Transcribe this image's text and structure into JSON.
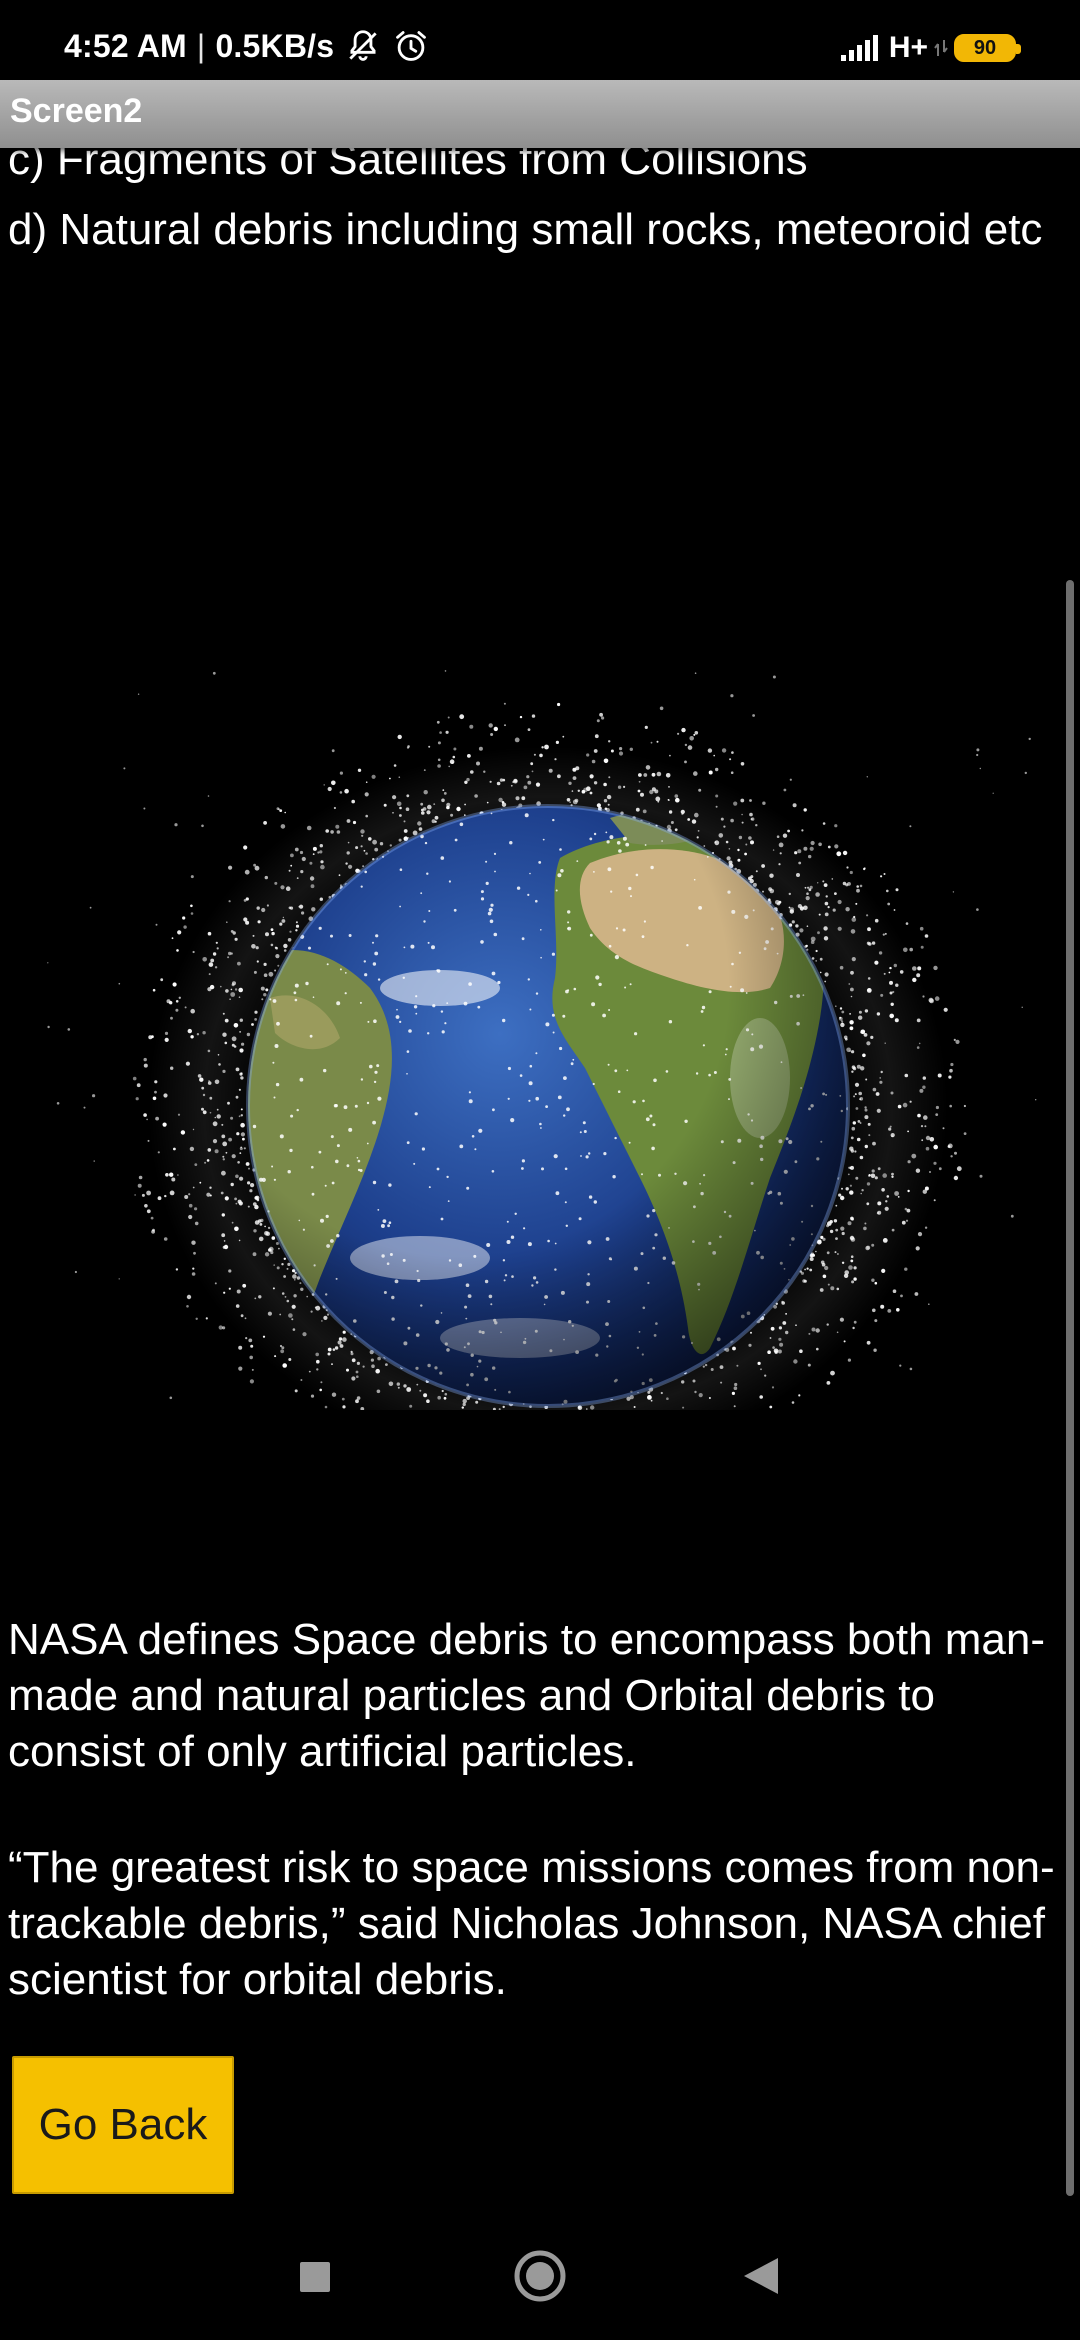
{
  "status_bar": {
    "time": "4:52 AM",
    "separator": "|",
    "net_speed": "0.5KB/s",
    "network_type": "H+",
    "battery_level": "90",
    "icons": [
      "notifications-off-icon",
      "alarm-icon",
      "signal-icon",
      "battery-icon"
    ]
  },
  "app_bar": {
    "title": "Screen2"
  },
  "content": {
    "item_c": "c) Fragments of Satellites from Collisions",
    "item_d": "d) Natural debris including small rocks, meteoroid etc",
    "image": {
      "name": "earth-space-debris-image"
    },
    "paragraph_1": "NASA defines Space debris to encompass both man-made and natural particles and Orbital debris to consist of only artificial particles.",
    "paragraph_2": "“The greatest risk to space missions comes from non-trackable debris,” said Nicholas Johnson, NASA chief scientist for orbital debris."
  },
  "buttons": {
    "go_back": "Go Back"
  },
  "colors": {
    "accent_button": "#f5c000",
    "app_bar": "#a8a8a8",
    "background": "#000000",
    "battery": "#f2b705"
  },
  "nav_bar": {
    "icons": [
      "recents-square-icon",
      "home-circle-icon",
      "back-triangle-icon"
    ]
  }
}
